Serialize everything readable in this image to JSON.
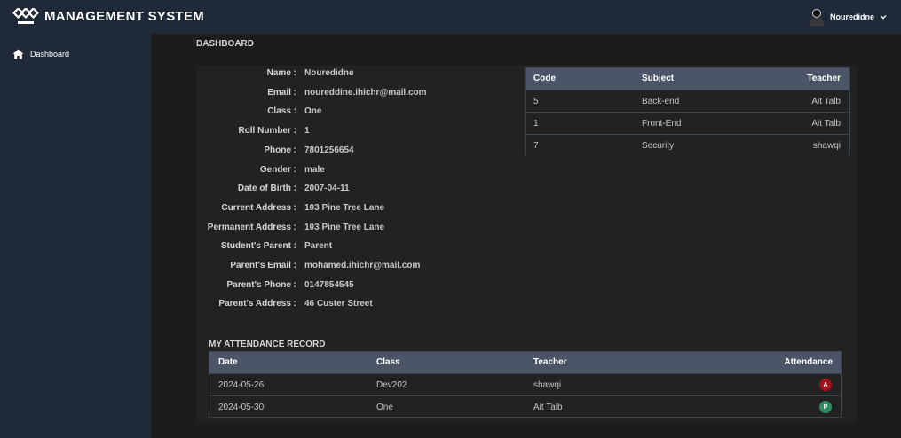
{
  "header": {
    "brand": "MANAGEMENT SYSTEM",
    "user_name": "Nouredidne"
  },
  "sidebar": {
    "items": [
      {
        "label": "Dashboard",
        "icon": "home-icon"
      }
    ]
  },
  "main": {
    "title": "DASHBOARD"
  },
  "profile": [
    {
      "label": "Name :",
      "value": "Nouredidne"
    },
    {
      "label": "Email :",
      "value": "noureddine.ihichr@mail.com"
    },
    {
      "label": "Class :",
      "value": "One"
    },
    {
      "label": "Roll Number :",
      "value": "1"
    },
    {
      "label": "Phone :",
      "value": "7801256654"
    },
    {
      "label": "Gender :",
      "value": "male"
    },
    {
      "label": "Date of Birth :",
      "value": "2007-04-11"
    },
    {
      "label": "Current Address :",
      "value": "103 Pine Tree Lane"
    },
    {
      "label": "Permanent Address :",
      "value": "103 Pine Tree Lane"
    },
    {
      "label": "Student's Parent :",
      "value": "Parent"
    },
    {
      "label": "Parent's Email :",
      "value": "mohamed.ihichr@mail.com"
    },
    {
      "label": "Parent's Phone :",
      "value": "0147854545"
    },
    {
      "label": "Parent's Address :",
      "value": "46 Custer Street"
    }
  ],
  "subjects": {
    "headers": [
      "Code",
      "Subject",
      "Teacher"
    ],
    "rows": [
      [
        "5",
        "Back-end",
        "Ait Talb"
      ],
      [
        "1",
        "Front-End",
        "Ait Talb"
      ],
      [
        "7",
        "Security",
        "shawqi"
      ]
    ]
  },
  "attendance": {
    "title": "MY ATTENDANCE RECORD",
    "headers": [
      "Date",
      "Class",
      "Teacher",
      "Attendance"
    ],
    "rows": [
      [
        "2024-05-26",
        "Dev202",
        "shawqi",
        "A"
      ],
      [
        "2024-05-30",
        "One",
        "Ait Talb",
        "P"
      ]
    ],
    "status_colors": {
      "A": "#a3111a",
      "P": "#2e8b63"
    }
  },
  "colors": {
    "topbar": "#1f2937",
    "table_header": "#4b5567",
    "background": "#1c1c1c"
  }
}
